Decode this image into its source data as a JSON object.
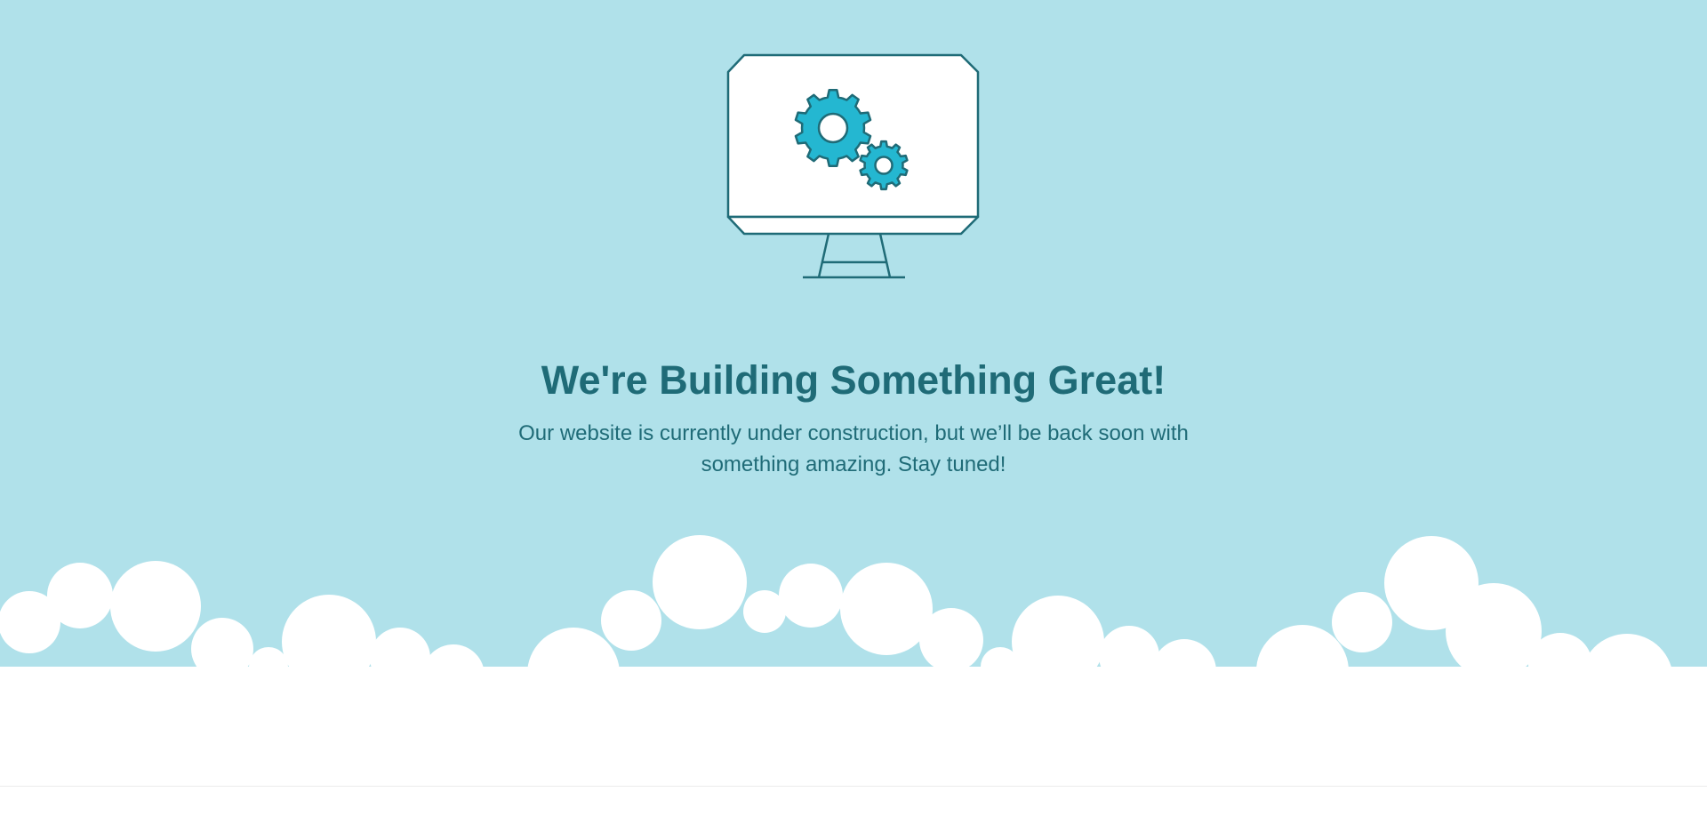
{
  "page": {
    "headline": "We're Building Something Great!",
    "message": "Our website is currently under construction, but we’ll be back soon with something amazing. Stay tuned!"
  },
  "illustration": {
    "subject": "monitor-with-gears",
    "icons": [
      "monitor-icon",
      "gear-icon"
    ]
  },
  "colors": {
    "sky": "#b0e1ea",
    "text": "#1f6b77",
    "gear_fill": "#24b7d1",
    "outline": "#1f6b77",
    "cloud": "#ffffff"
  }
}
